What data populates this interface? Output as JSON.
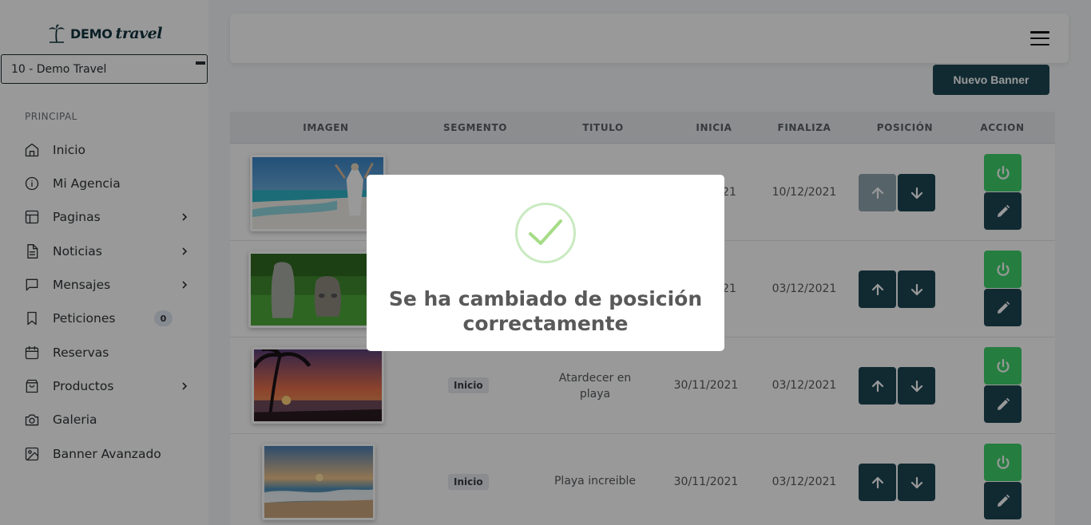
{
  "sidebar": {
    "logo": {
      "demo": "DEMO",
      "travel": "travel"
    },
    "agency_select": "10 - Demo Travel",
    "section_label": "PRINCIPAL",
    "items": [
      {
        "label": "Inicio",
        "icon": "home-icon"
      },
      {
        "label": "Mi Agencia",
        "icon": "info-icon"
      },
      {
        "label": "Paginas",
        "icon": "layout-icon",
        "has_submenu": true
      },
      {
        "label": "Noticias",
        "icon": "file-text-icon",
        "has_submenu": true
      },
      {
        "label": "Mensajes",
        "icon": "message-icon",
        "has_submenu": true
      },
      {
        "label": "Peticiones",
        "icon": "bookmark-icon",
        "badge": "0"
      },
      {
        "label": "Reservas",
        "icon": "calendar-icon"
      },
      {
        "label": "Productos",
        "icon": "shopping-bag-icon",
        "has_submenu": true
      },
      {
        "label": "Galeria",
        "icon": "camera-icon"
      },
      {
        "label": "Banner Avanzado",
        "icon": "image-icon"
      }
    ]
  },
  "header": {
    "menu_icon": "hamburger-menu-icon"
  },
  "toolbar": {
    "new_banner_label": "Nuevo Banner"
  },
  "table": {
    "columns": [
      "IMAGEN",
      "SEGMENTO",
      "TITULO",
      "INICIA",
      "FINALIZA",
      "POSICIÓN",
      "ACCION"
    ],
    "rows": [
      {
        "image": "beach-woman-photo",
        "segment": "",
        "title": "",
        "start": "21",
        "end": "10/12/2021",
        "up_disabled": true
      },
      {
        "image": "olmec-heads-photo",
        "segment": "",
        "title": "",
        "start": "21",
        "end": "03/12/2021",
        "up_disabled": false
      },
      {
        "image": "palm-sunset-photo",
        "segment": "Inicio",
        "title": "Atardecer en playa",
        "start": "30/11/2021",
        "end": "03/12/2021",
        "up_disabled": false
      },
      {
        "image": "beach-sunset-photo",
        "segment": "Inicio",
        "title": "Playa increible",
        "start": "30/11/2021",
        "end": "03/12/2021",
        "up_disabled": false
      }
    ]
  },
  "modal": {
    "icon": "success-check-icon",
    "message": "Se ha cambiado de posición correctamente"
  },
  "colors": {
    "primary": "#1d4654",
    "success": "#3fd26b",
    "check": "#a5dc86"
  }
}
